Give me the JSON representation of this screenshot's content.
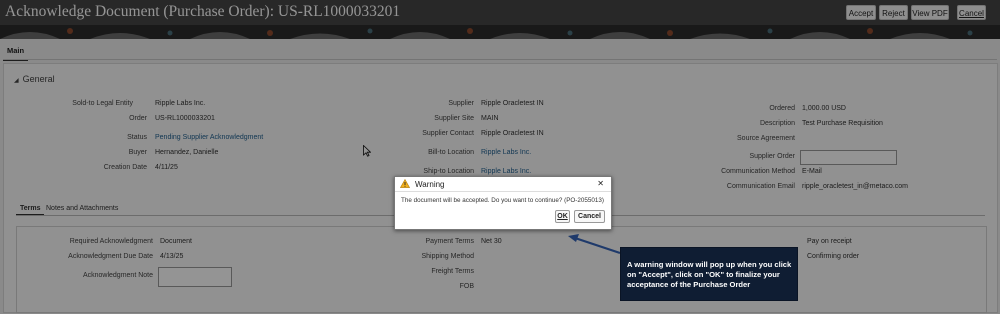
{
  "header": {
    "title": "Acknowledge Document (Purchase Order): US-RL1000033201",
    "buttons": {
      "accept": "Accept",
      "reject": "Reject",
      "view_pdf": "View PDF",
      "cancel": "Cancel"
    }
  },
  "tabs": {
    "main": "Main"
  },
  "general": {
    "heading": "General",
    "col1": [
      {
        "label": "Sold-to Legal Entity",
        "value": "Ripple Labs Inc."
      },
      {
        "label": "Order",
        "value": "US-RL1000033201"
      },
      {
        "label": "Status",
        "value": "Pending Supplier Acknowledgment"
      },
      {
        "label": "Buyer",
        "value": "Hernandez, Danielle"
      },
      {
        "label": "Creation Date",
        "value": "4/11/25"
      }
    ],
    "col2": [
      {
        "label": "Supplier",
        "value": "Ripple Oracletest IN"
      },
      {
        "label": "Supplier Site",
        "value": "MAIN"
      },
      {
        "label": "Supplier Contact",
        "value": "Ripple Oracletest IN"
      },
      {
        "label": "Bill-to Location",
        "value": "Ripple Labs Inc."
      },
      {
        "label": "Ship-to Location",
        "value": "Ripple Labs Inc."
      }
    ],
    "col3": [
      {
        "label": "Ordered",
        "value": "1,000.00 USD"
      },
      {
        "label": "Description",
        "value": "Test Purchase Requisition"
      },
      {
        "label": "Source Agreement",
        "value": ""
      },
      {
        "label": "Supplier Order",
        "value": ""
      },
      {
        "label": "Communication Method",
        "value": "E-Mail"
      },
      {
        "label": "Communication Email",
        "value": "ripple_oracletest_in@metaco.com"
      }
    ]
  },
  "subtabs": {
    "terms": "Terms",
    "notes": "Notes and Attachments"
  },
  "terms": {
    "left": [
      {
        "label": "Required Acknowledgment",
        "value": "Document"
      },
      {
        "label": "Acknowledgment Due Date",
        "value": "4/13/25"
      },
      {
        "label": "Acknowledgment Note",
        "value": ""
      }
    ],
    "mid": [
      {
        "label": "Payment Terms",
        "value": "Net 30"
      },
      {
        "label": "Shipping Method",
        "value": ""
      },
      {
        "label": "Freight Terms",
        "value": ""
      },
      {
        "label": "FOB",
        "value": ""
      }
    ],
    "right": [
      "Pay on receipt",
      "Confirming order"
    ]
  },
  "dialog": {
    "title": "Warning",
    "message": "The document will be accepted. Do you want to continue? (PO-2055013)",
    "ok": "OK",
    "cancel": "Cancel",
    "close_glyph": "✕"
  },
  "callout": {
    "text": "A warning window will pop up when you click on \"Accept\", click on \"OK\" to finalize your acceptance of the Purchase Order"
  },
  "colors": {
    "accent_link": "#1f5f8f",
    "callout_bg": "#0f1d33",
    "arrow": "#1f3a6b",
    "warning": "#f2b01e"
  },
  "icons": [
    "warning-icon",
    "close-icon",
    "collapse-triangle-icon",
    "mouse-cursor-icon",
    "callout-arrow"
  ]
}
